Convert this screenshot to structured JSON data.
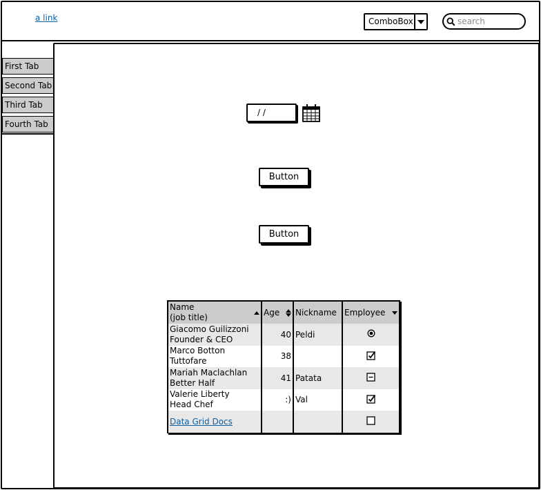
{
  "header": {
    "link_label": "a link",
    "combobox_value": "ComboBox",
    "search_placeholder": "search"
  },
  "sidebar": {
    "tabs": [
      {
        "label": "First Tab"
      },
      {
        "label": "Second Tab"
      },
      {
        "label": "Third Tab"
      },
      {
        "label": "Fourth Tab"
      }
    ]
  },
  "main": {
    "date_value": "/ /",
    "button1_label": "Button",
    "button2_label": "Button"
  },
  "grid": {
    "columns": {
      "name_line1": "Name",
      "name_line2": "(job title)",
      "age": "Age",
      "nickname": "Nickname",
      "employee": "Employee"
    },
    "rows": [
      {
        "name": "Giacomo Guilizzoni",
        "title": "Founder & CEO",
        "age": "40",
        "nickname": "Peldi",
        "employee": "radio-selected"
      },
      {
        "name": "Marco Botton",
        "title": "Tuttofare",
        "age": "38",
        "nickname": "",
        "employee": "checked"
      },
      {
        "name": "Mariah Maclachlan",
        "title": "Better Half",
        "age": "41",
        "nickname": "Patata",
        "employee": "indeterminate"
      },
      {
        "name": "Valerie Liberty",
        "title": "Head Chef",
        "age": ":)",
        "nickname": "Val",
        "employee": "checked"
      }
    ],
    "footer_link": "Data Grid Docs",
    "footer_employee": "unchecked"
  },
  "colors": {
    "link": "#0b5fa4",
    "tab_bg": "#cccccc",
    "grid_header_bg": "#cccccc",
    "grid_alt_row_bg": "#e8e8e8"
  },
  "icons": {
    "search": "search-icon",
    "calendar": "calendar-icon",
    "combobox_arrow": "chevron-down-icon"
  }
}
